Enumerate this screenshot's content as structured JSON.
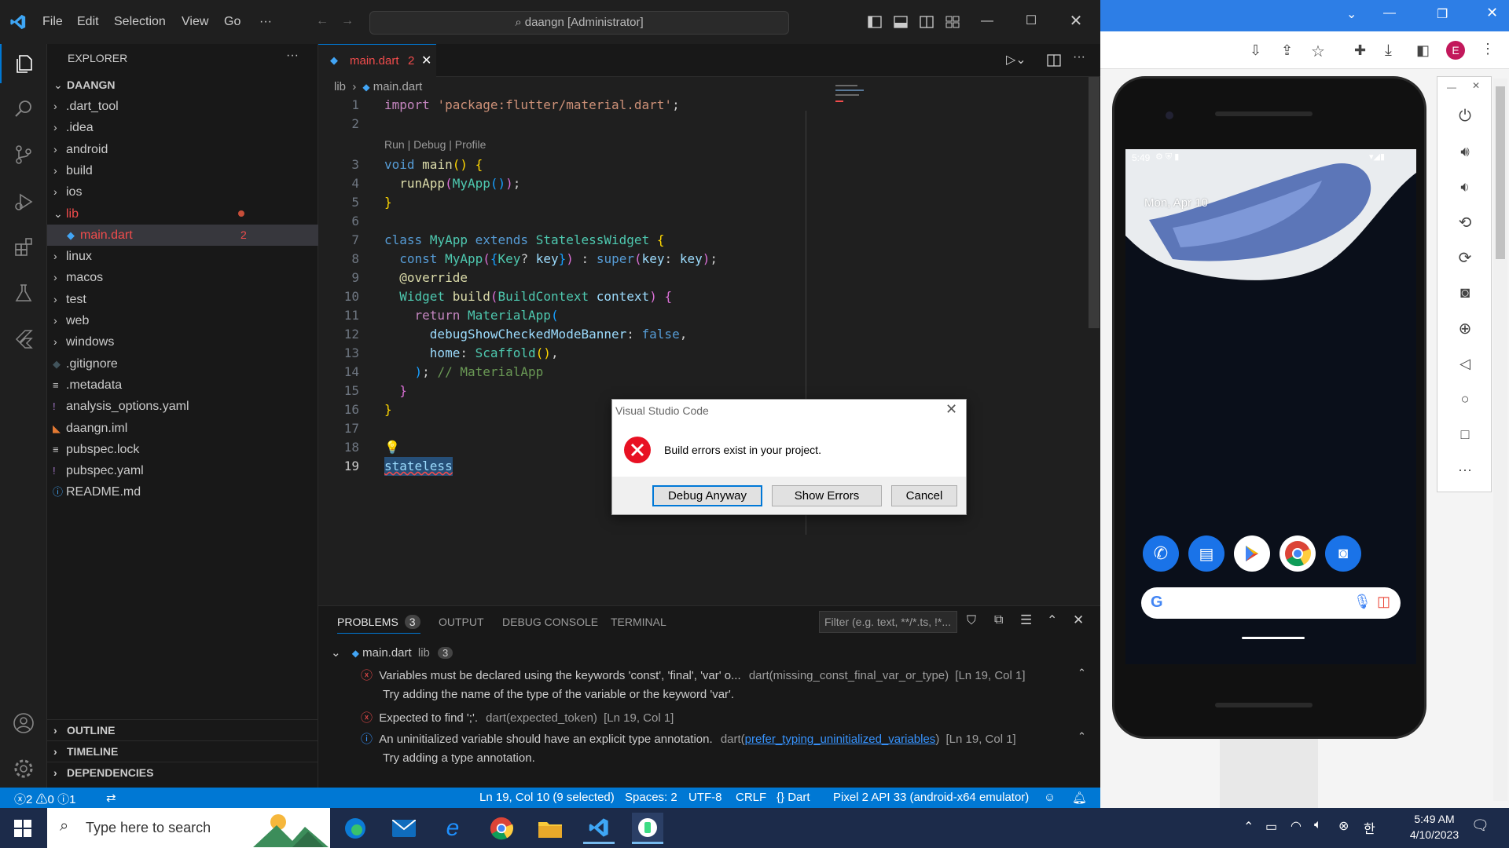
{
  "titlebar": {
    "menu": [
      "File",
      "Edit",
      "Selection",
      "View",
      "Go",
      "···"
    ],
    "search": "daangn [Administrator]"
  },
  "explorer": {
    "header": "EXPLORER",
    "more": "···",
    "root": "DAANGN",
    "items": [
      {
        "label": ".dart_tool",
        "type": "folder"
      },
      {
        "label": ".idea",
        "type": "folder"
      },
      {
        "label": "android",
        "type": "folder"
      },
      {
        "label": "build",
        "type": "folder"
      },
      {
        "label": "ios",
        "type": "folder"
      },
      {
        "label": "lib",
        "type": "folder-open"
      },
      {
        "label": "main.dart",
        "type": "file",
        "badge": "2"
      },
      {
        "label": "linux",
        "type": "folder"
      },
      {
        "label": "macos",
        "type": "folder"
      },
      {
        "label": "test",
        "type": "folder"
      },
      {
        "label": "web",
        "type": "folder"
      },
      {
        "label": "windows",
        "type": "folder"
      },
      {
        "label": ".gitignore",
        "type": "file"
      },
      {
        "label": ".metadata",
        "type": "file"
      },
      {
        "label": "analysis_options.yaml",
        "type": "file"
      },
      {
        "label": "daangn.iml",
        "type": "file"
      },
      {
        "label": "pubspec.lock",
        "type": "file"
      },
      {
        "label": "pubspec.yaml",
        "type": "file"
      },
      {
        "label": "README.md",
        "type": "file"
      }
    ],
    "sections": [
      "OUTLINE",
      "TIMELINE",
      "DEPENDENCIES"
    ]
  },
  "editor": {
    "tab_label": "main.dart",
    "tab_badge": "2",
    "breadcrumb_folder": "lib",
    "breadcrumb_file": "main.dart",
    "codelens": "Run | Debug | Profile",
    "line_numbers": [
      "1",
      "2",
      "3",
      "4",
      "5",
      "6",
      "7",
      "8",
      "9",
      "10",
      "11",
      "12",
      "13",
      "14",
      "15",
      "16",
      "17",
      "18",
      "19"
    ]
  },
  "panel": {
    "tabs": [
      "PROBLEMS",
      "OUTPUT",
      "DEBUG CONSOLE",
      "TERMINAL"
    ],
    "problems_count": "3",
    "filter_placeholder": "Filter (e.g. text, **/*.ts, !*...",
    "group_file": "main.dart",
    "group_folder": "lib",
    "group_count": "3",
    "problems": [
      {
        "severity": "error",
        "message": "Variables must be declared using the keywords 'const', 'final', 'var' o...",
        "source": "dart(missing_const_final_var_or_type)",
        "location": "[Ln 19, Col 1]",
        "hint": "Try adding the name of the type of the variable or the keyword 'var'."
      },
      {
        "severity": "error",
        "message": "Expected to find ';'.",
        "source": "dart(expected_token)",
        "location": "[Ln 19, Col 1]",
        "hint": ""
      },
      {
        "severity": "info",
        "message": "An uninitialized variable should have an explicit type annotation.",
        "source_prefix": "dart(",
        "source_link": "prefer_typing_uninitialized_variables",
        "source_suffix": ")",
        "location": "[Ln 19, Col 1]",
        "hint": "Try adding a type annotation."
      }
    ]
  },
  "statusbar": {
    "errors": "2",
    "warnings": "0",
    "infos": "1",
    "position": "Ln 19, Col 10 (9 selected)",
    "spaces": "Spaces: 2",
    "encoding": "UTF-8",
    "eol": "CRLF",
    "language": "Dart",
    "device": "Pixel 2 API 33 (android-x64 emulator)"
  },
  "dialog": {
    "title": "Visual Studio Code",
    "message": "Build errors exist in your project.",
    "buttons": [
      "Debug Anyway",
      "Show Errors",
      "Cancel"
    ]
  },
  "emulator": {
    "time": "5:49",
    "date": "Mon, Apr 10",
    "profile_initial": "E"
  },
  "taskbar": {
    "search_placeholder": "Type here to search",
    "clock_time": "5:49 AM",
    "clock_date": "4/10/2023"
  },
  "colors": {
    "accent": "#0078d4",
    "error": "#f14c4c",
    "info": "#3794ff",
    "modified": "#e2c08d"
  }
}
